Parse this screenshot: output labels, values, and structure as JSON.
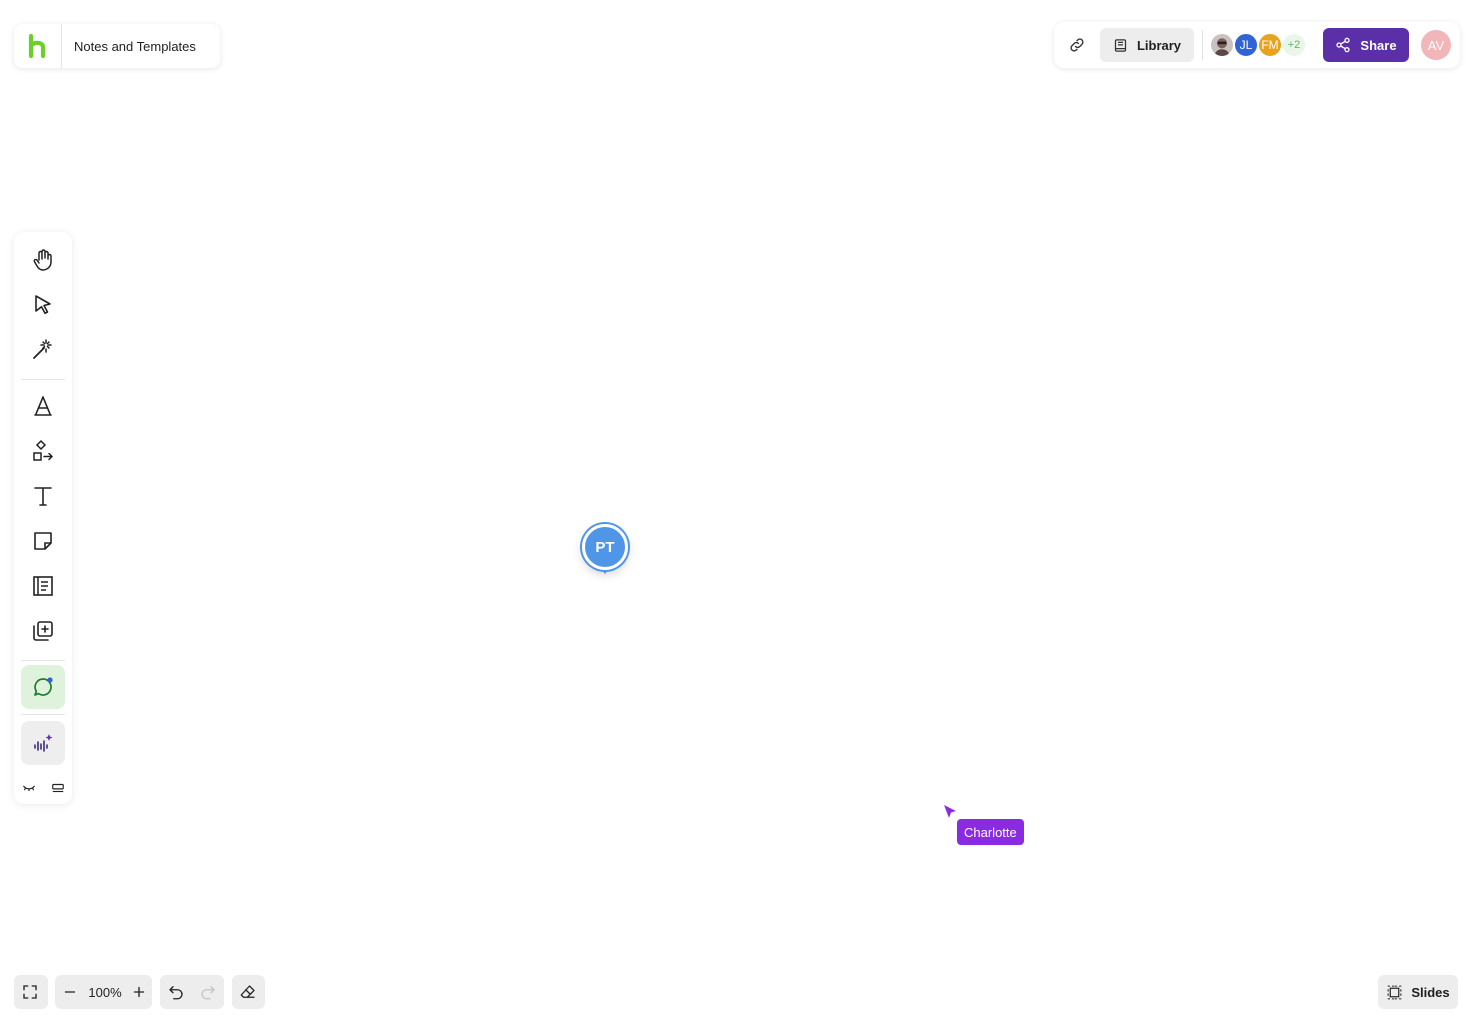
{
  "board": {
    "title": "Notes and Templates",
    "logo_icon": "h-logo-icon",
    "logo_color": "#6bd12a"
  },
  "topbar": {
    "link_icon": "link-icon",
    "library_label": "Library",
    "library_icon": "book-icon",
    "collaborators": [
      {
        "initials": "",
        "type": "photo"
      },
      {
        "initials": "JL",
        "color": "#2f64d6"
      },
      {
        "initials": "FM",
        "color": "#e8a21c"
      }
    ],
    "more_collaborators": "+2",
    "share_label": "Share",
    "share_color": "#5b2fa8",
    "current_user_initials": "AV"
  },
  "tools": [
    {
      "name": "hand-tool",
      "icon": "hand-icon"
    },
    {
      "name": "select-tool",
      "icon": "cursor-icon"
    },
    {
      "name": "magic-tool",
      "icon": "magic-wand-icon"
    },
    {
      "name": "pen-tool",
      "icon": "pen-nib-icon"
    },
    {
      "name": "shapes-tool",
      "icon": "shapes-connector-icon"
    },
    {
      "name": "text-tool",
      "icon": "text-icon"
    },
    {
      "name": "sticky-note-tool",
      "icon": "sticky-note-icon"
    },
    {
      "name": "template-tool",
      "icon": "template-icon"
    },
    {
      "name": "add-frame-tool",
      "icon": "add-copy-icon"
    },
    {
      "name": "comment-tool",
      "icon": "comment-icon"
    },
    {
      "name": "ai-tool",
      "icon": "sparkle-audio-icon"
    }
  ],
  "rail_footer": {
    "collapse_icon": "eye-closed-icon",
    "layout_icon": "minimize-icon"
  },
  "canvas": {
    "pin_initials": "PT",
    "pin_color": "#4f95e8",
    "cursor_user": "Charlotte",
    "cursor_color": "#8a2be2"
  },
  "bottom": {
    "zoom_level": "100%",
    "slides_label": "Slides"
  }
}
